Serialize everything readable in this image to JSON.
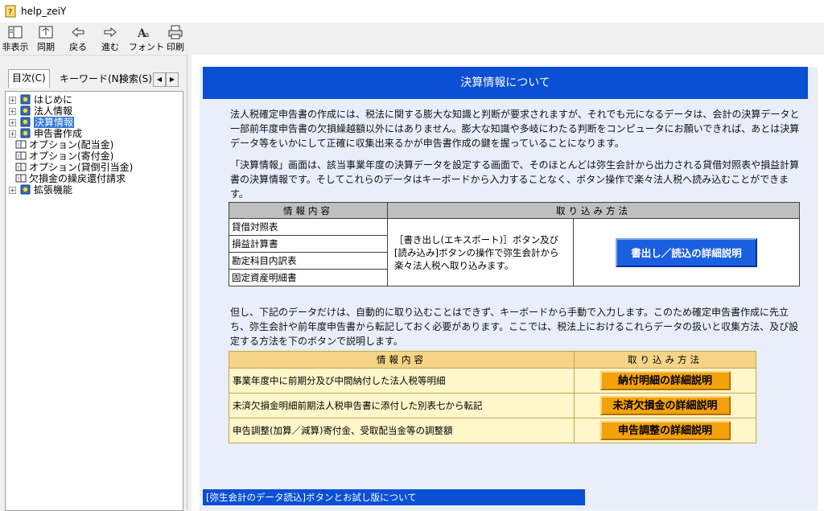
{
  "window": {
    "title": "help_zeiY"
  },
  "toolbar": {
    "hide_label": "非表示",
    "sync_label": "同期",
    "back_label": "戻る",
    "forward_label": "進む",
    "font_label": "フォント",
    "print_label": "印刷"
  },
  "nav": {
    "tabs": [
      "目次(C)",
      "キーワード(N)",
      "検索(S)"
    ],
    "tree": [
      {
        "label": "はじめに",
        "type": "book",
        "expandable": true
      },
      {
        "label": "法人情報",
        "type": "book",
        "expandable": true
      },
      {
        "label": "決算情報",
        "type": "book",
        "expandable": true,
        "selected": true
      },
      {
        "label": "申告書作成",
        "type": "book",
        "expandable": true
      },
      {
        "label": "オプション(配当金)",
        "type": "page",
        "expandable": false
      },
      {
        "label": "オプション(寄付金)",
        "type": "page",
        "expandable": false
      },
      {
        "label": "オプション(貸倒引当金)",
        "type": "page",
        "expandable": false
      },
      {
        "label": "欠損金の繰戻還付請求",
        "type": "page",
        "expandable": false
      },
      {
        "label": "拡張機能",
        "type": "book",
        "expandable": true
      }
    ]
  },
  "content": {
    "header": "決算情報について",
    "para1": "法人税確定申告書の作成には、税法に関する膨大な知識と判断が要求されますが、それでも元になるデータは、会計の決算データと一部前年度申告書の欠損繰越額以外にはありません。膨大な知識や多岐にわたる判断をコンピュータにお願いできれば、あとは決算データ等をいかにして正確に収集出来るかが申告書作成の鍵を握っていることになります。",
    "para2": "「決算情報」画面は、該当事業年度の決算データを設定する画面で、そのほとんどは弥生会計から出力される貸借対照表や損益計算書の決算情報です。そしてこれらのデータはキーボードから入力することなく、ボタン操作で楽々法人税へ読み込むことができます。",
    "table1": {
      "col1": "情報内容",
      "col2": "取り込み方法",
      "rows": [
        "貸借対照表",
        "損益計算書",
        "勘定科目内訳表",
        "固定資産明細書"
      ],
      "method": "［書き出し(エキスポート)］ボタン及び[読み込み]ボタンの操作で弥生会計から楽々法人税へ取り込みます。",
      "button": "書出し／読込の詳細説明"
    },
    "para3": "但し、下記のデータだけは、自動的に取り込むことはできず、キーボードから手動で入力します。このため確定申告書作成に先立ち、弥生会計や前年度申告書から転記しておく必要があります。ここでは、税法上におけるこれらデータの扱いと収集方法、及び設定する方法を下のボタンで説明します。",
    "table2": {
      "col1": "情報内容",
      "col2": "取り込み方法",
      "rows": [
        {
          "label": "事業年度中に前期分及び中間納付した法人税等明細",
          "button": "納付明細の詳細説明"
        },
        {
          "label": "未済欠損金明細前期法人税申告書に添付した別表七から転記",
          "button": "未済欠損金の詳細説明"
        },
        {
          "label": "申告調整(加算／減算)寄付金、受取配当金等の調整額",
          "button": "申告調整の詳細説明"
        }
      ]
    },
    "footer": "[弥生会計のデータ読込]ボタンとお試し版について"
  }
}
